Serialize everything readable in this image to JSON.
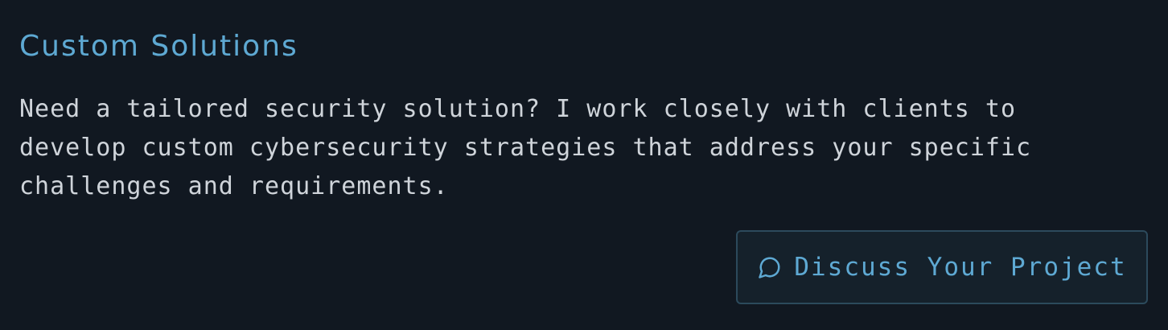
{
  "card": {
    "title": "Custom Solutions",
    "description": "Need a tailored security solution? I work closely with clients to develop custom cybersecurity strategies that address your specific challenges and requirements.",
    "cta": {
      "label": "Discuss Your Project",
      "icon": "chat-bubble-icon"
    }
  },
  "colors": {
    "background": "#111821",
    "accent": "#5ea9d3",
    "text": "#cfd4da",
    "button_border": "#2c4a5c",
    "button_bg": "#15212b"
  }
}
